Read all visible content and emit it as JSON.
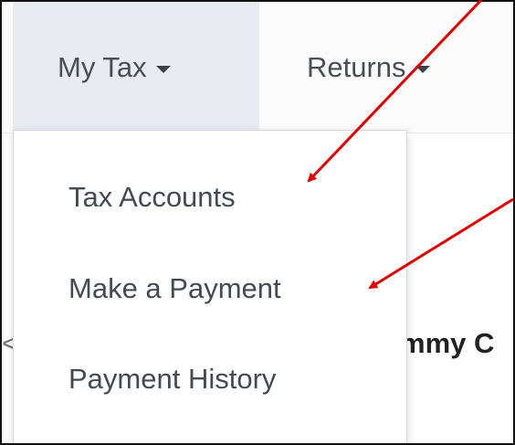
{
  "nav": {
    "my_tax": "My Tax",
    "returns": "Returns"
  },
  "dropdown": {
    "items": [
      "Tax Accounts",
      "Make a Payment",
      "Payment History"
    ]
  },
  "background": {
    "partial_heading": "mmy C",
    "partial_left": "<"
  },
  "colors": {
    "annotation_arrow": "#e10000",
    "nav_active_bg": "#e8ebf1"
  }
}
